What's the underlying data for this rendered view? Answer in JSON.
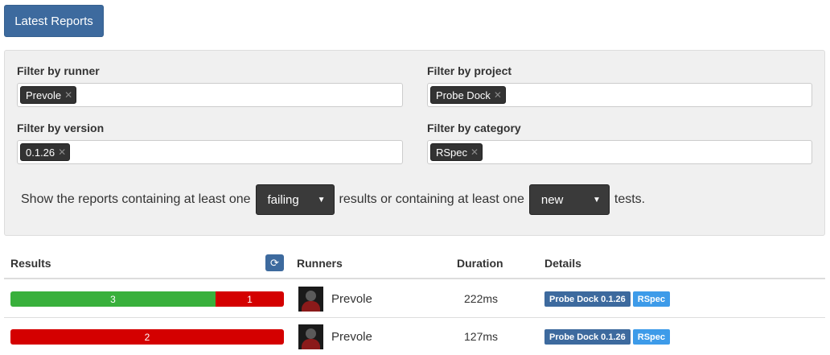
{
  "tabs": {
    "latest_reports": "Latest Reports"
  },
  "filters": {
    "runner": {
      "label": "Filter by runner",
      "tag": "Prevole"
    },
    "project": {
      "label": "Filter by project",
      "tag": "Probe Dock"
    },
    "version": {
      "label": "Filter by version",
      "tag": "0.1.26"
    },
    "category": {
      "label": "Filter by category",
      "tag": "RSpec"
    },
    "tag_remove_glyph": "✕"
  },
  "sentence": {
    "part1": "Show the reports containing at least one",
    "status_select": "failing",
    "part2": "results or containing at least one",
    "newness_select": "new",
    "part3": "tests."
  },
  "table": {
    "headers": {
      "results": "Results",
      "runners": "Runners",
      "duration": "Duration",
      "details": "Details"
    },
    "rows": [
      {
        "passed": "3",
        "failed": "1",
        "pass_fraction": 0.75,
        "runner": "Prevole",
        "duration": "222ms",
        "project_label": "Probe Dock 0.1.26",
        "category_label": "RSpec"
      },
      {
        "passed": "",
        "failed": "2",
        "pass_fraction": 0,
        "runner": "Prevole",
        "duration": "127ms",
        "project_label": "Probe Dock 0.1.26",
        "category_label": "RSpec"
      }
    ]
  },
  "colors": {
    "primary": "#3d6a9e",
    "pass": "#39b03c",
    "fail": "#d40000",
    "category": "#3d9be9"
  },
  "icons": {
    "refresh": "refresh-icon",
    "caret": "caret-down-icon",
    "remove": "close-icon"
  }
}
